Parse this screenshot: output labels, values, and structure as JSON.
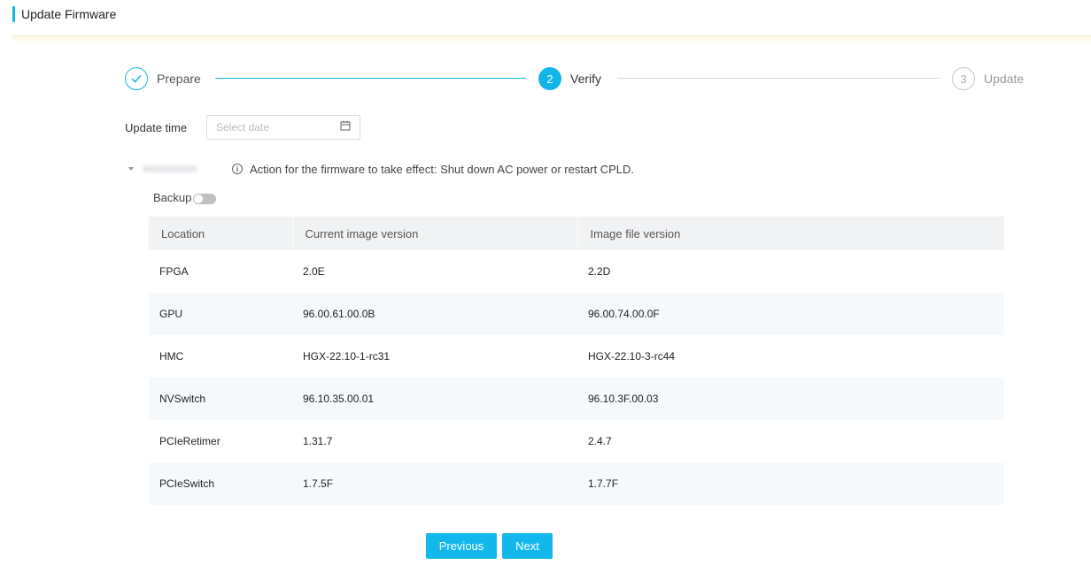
{
  "header": {
    "title": "Update Firmware"
  },
  "steps": [
    {
      "number": "",
      "label": "Prepare",
      "state": "done"
    },
    {
      "number": "2",
      "label": "Verify",
      "state": "active"
    },
    {
      "number": "3",
      "label": "Update",
      "state": "todo"
    }
  ],
  "update_time": {
    "label": "Update time",
    "placeholder": "Select date",
    "icon": "calendar-icon"
  },
  "device": {
    "action_text": "Action for the firmware to take effect: Shut down AC power or restart CPLD.",
    "info_icon": "info-icon"
  },
  "backup": {
    "label": "Backup",
    "enabled": false
  },
  "table": {
    "headers": [
      "Location",
      "Current image version",
      "Image file version"
    ],
    "rows": [
      [
        "FPGA",
        "2.0E",
        "2.2D"
      ],
      [
        "GPU",
        "96.00.61.00.0B",
        "96.00.74.00.0F"
      ],
      [
        "HMC",
        "HGX-22.10-1-rc31",
        "HGX-22.10-3-rc44"
      ],
      [
        "NVSwitch",
        "96.10.35.00.01",
        "96.10.3F.00.03"
      ],
      [
        "PCIeRetimer",
        "1.31.7",
        "2.4.7"
      ],
      [
        "PCIeSwitch",
        "1.7.5F",
        "1.7.7F"
      ]
    ]
  },
  "buttons": {
    "previous": "Previous",
    "next": "Next"
  },
  "colors": {
    "accent": "#12b5e8",
    "header_bg": "#f0f2f4",
    "alt_row": "#f6f9fb"
  }
}
